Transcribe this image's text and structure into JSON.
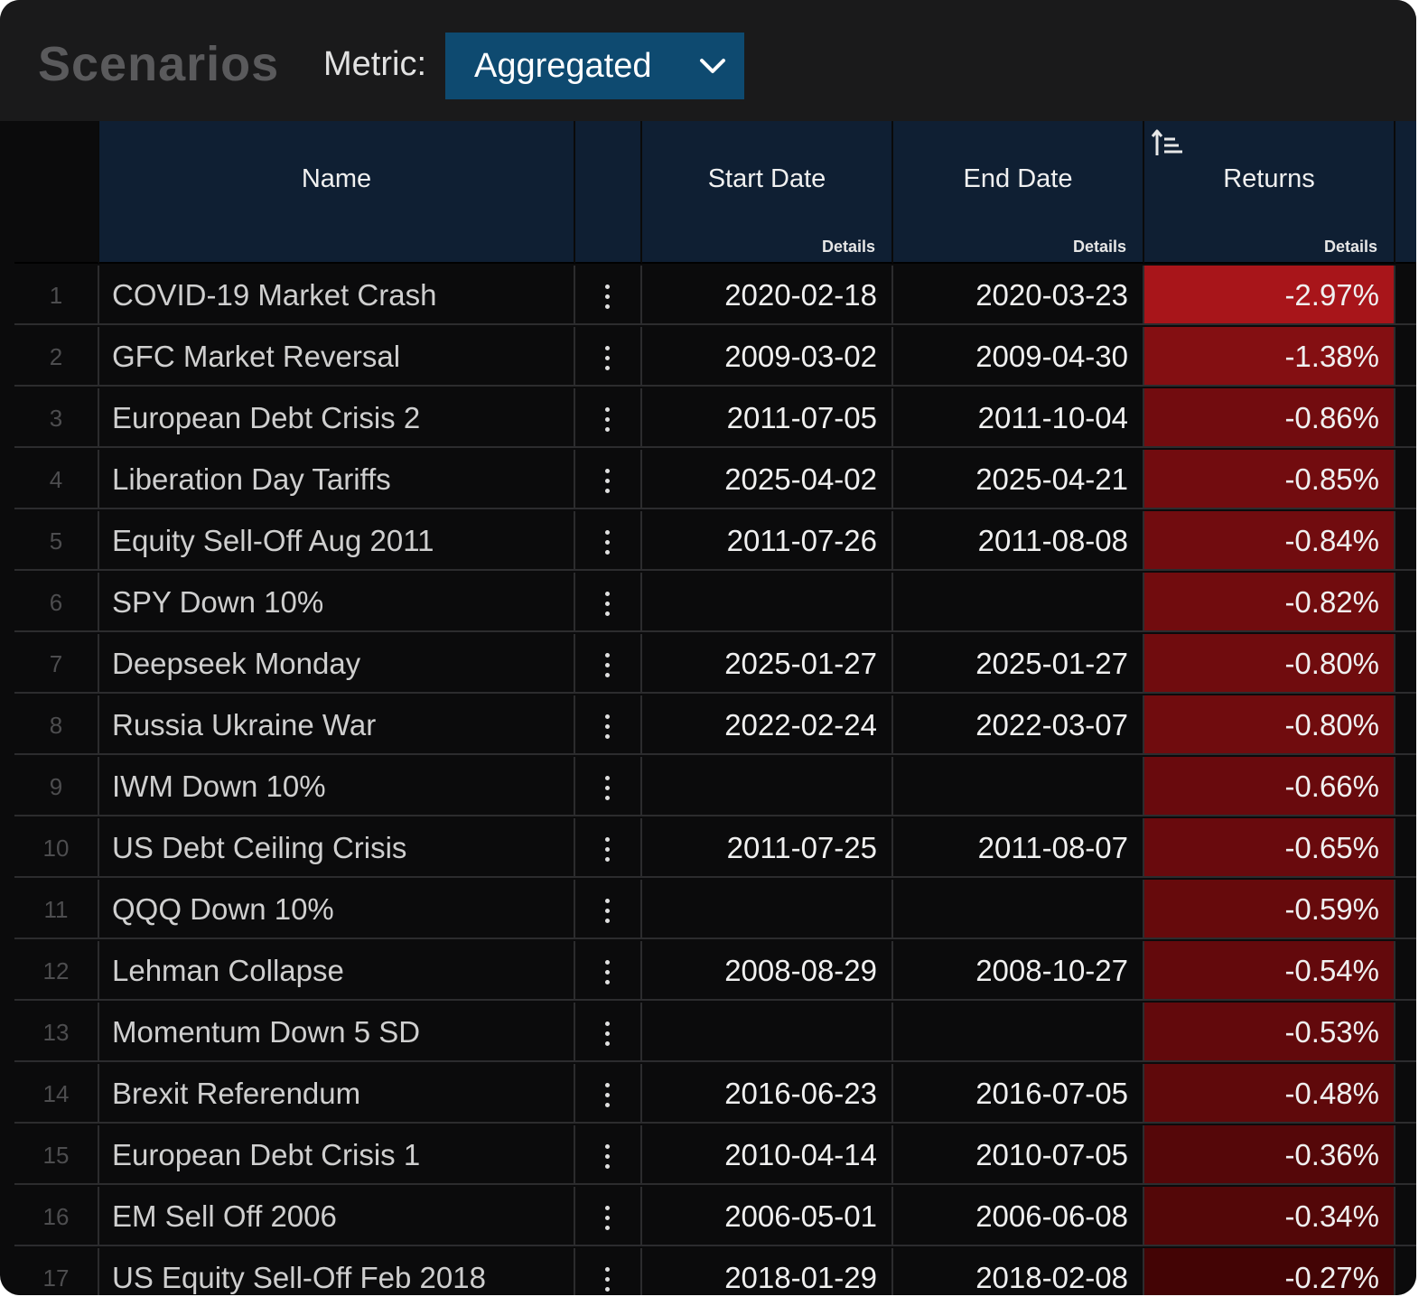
{
  "header": {
    "title": "Scenarios",
    "metric_label": "Metric:",
    "metric_value": "Aggregated"
  },
  "columns": {
    "name": "Name",
    "start_date": "Start Date",
    "end_date": "End Date",
    "returns": "Returns",
    "details": "Details"
  },
  "icons": {
    "dropdown": "chevron-down-icon",
    "sort": "sort-ascending-icon",
    "row_menu": "kebab-menu-icon"
  },
  "colors": {
    "select_bg": "#0e4a70",
    "header_bg": "#0f1f33",
    "return_strong": "#a8151a",
    "return_weak": "#430405"
  },
  "rows": [
    {
      "num": "1",
      "name": "COVID-19 Market Crash",
      "start": "2020-02-18",
      "end": "2020-03-23",
      "ret": "-2.97%",
      "value": -2.97
    },
    {
      "num": "2",
      "name": "GFC Market Reversal",
      "start": "2009-03-02",
      "end": "2009-04-30",
      "ret": "-1.38%",
      "value": -1.38
    },
    {
      "num": "3",
      "name": "European Debt Crisis 2",
      "start": "2011-07-05",
      "end": "2011-10-04",
      "ret": "-0.86%",
      "value": -0.86
    },
    {
      "num": "4",
      "name": "Liberation Day Tariffs",
      "start": "2025-04-02",
      "end": "2025-04-21",
      "ret": "-0.85%",
      "value": -0.85
    },
    {
      "num": "5",
      "name": "Equity Sell-Off Aug 2011",
      "start": "2011-07-26",
      "end": "2011-08-08",
      "ret": "-0.84%",
      "value": -0.84
    },
    {
      "num": "6",
      "name": "SPY Down 10%",
      "start": "",
      "end": "",
      "ret": "-0.82%",
      "value": -0.82
    },
    {
      "num": "7",
      "name": "Deepseek Monday",
      "start": "2025-01-27",
      "end": "2025-01-27",
      "ret": "-0.80%",
      "value": -0.8
    },
    {
      "num": "8",
      "name": "Russia Ukraine War",
      "start": "2022-02-24",
      "end": "2022-03-07",
      "ret": "-0.80%",
      "value": -0.8
    },
    {
      "num": "9",
      "name": "IWM Down 10%",
      "start": "",
      "end": "",
      "ret": "-0.66%",
      "value": -0.66
    },
    {
      "num": "10",
      "name": "US Debt Ceiling Crisis",
      "start": "2011-07-25",
      "end": "2011-08-07",
      "ret": "-0.65%",
      "value": -0.65
    },
    {
      "num": "11",
      "name": "QQQ Down 10%",
      "start": "",
      "end": "",
      "ret": "-0.59%",
      "value": -0.59
    },
    {
      "num": "12",
      "name": "Lehman Collapse",
      "start": "2008-08-29",
      "end": "2008-10-27",
      "ret": "-0.54%",
      "value": -0.54
    },
    {
      "num": "13",
      "name": "Momentum Down 5 SD",
      "start": "",
      "end": "",
      "ret": "-0.53%",
      "value": -0.53
    },
    {
      "num": "14",
      "name": "Brexit Referendum",
      "start": "2016-06-23",
      "end": "2016-07-05",
      "ret": "-0.48%",
      "value": -0.48
    },
    {
      "num": "15",
      "name": "European Debt Crisis 1",
      "start": "2010-04-14",
      "end": "2010-07-05",
      "ret": "-0.36%",
      "value": -0.36
    },
    {
      "num": "16",
      "name": "EM Sell Off 2006",
      "start": "2006-05-01",
      "end": "2006-06-08",
      "ret": "-0.34%",
      "value": -0.34
    },
    {
      "num": "17",
      "name": "US Equity Sell-Off Feb 2018",
      "start": "2018-01-29",
      "end": "2018-02-08",
      "ret": "-0.27%",
      "value": -0.27
    }
  ]
}
